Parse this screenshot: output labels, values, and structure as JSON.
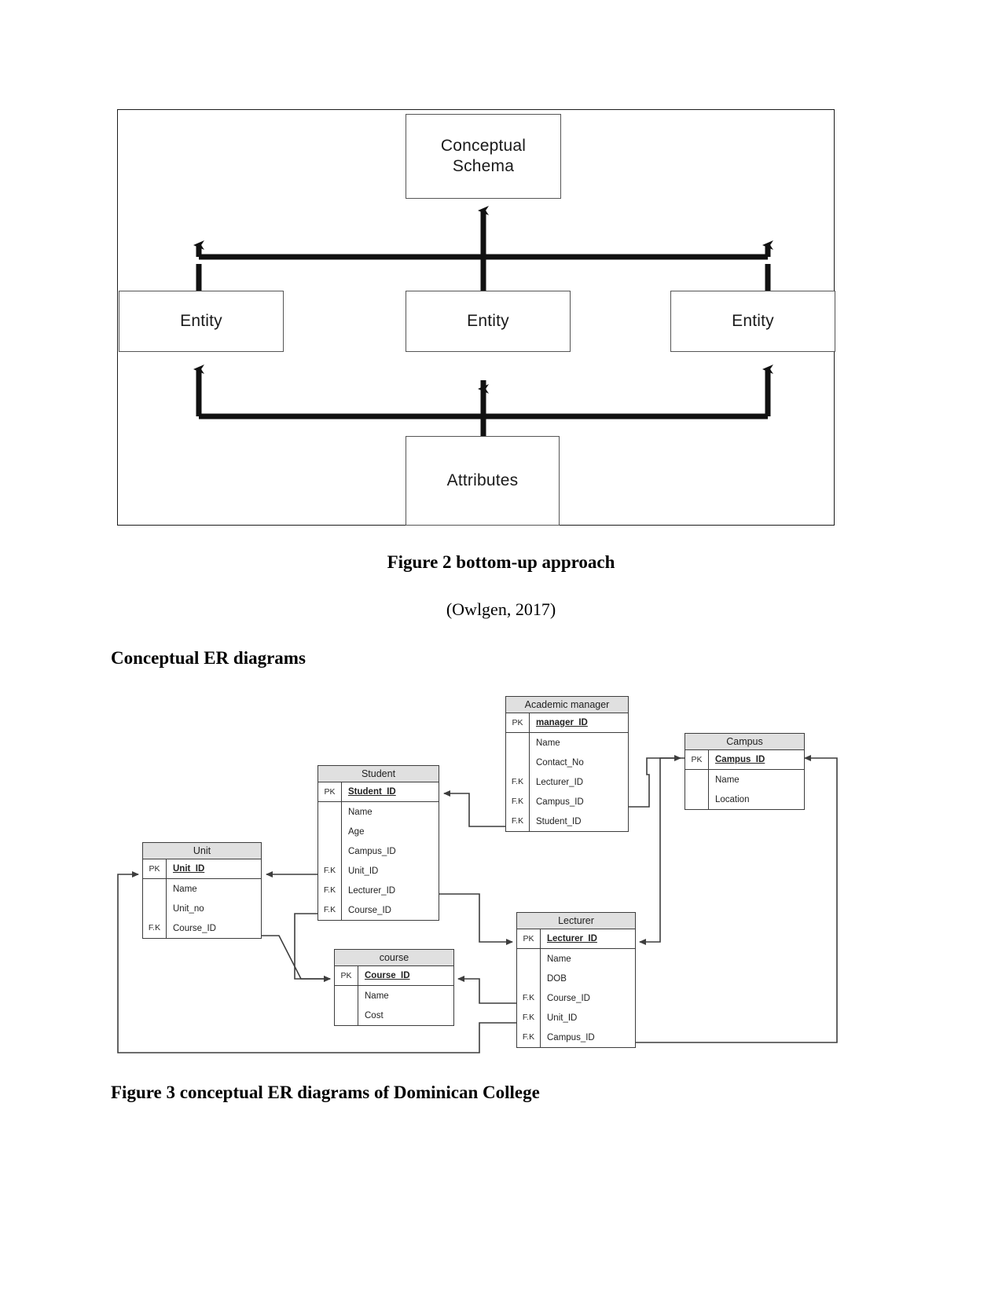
{
  "figure2": {
    "boxes": {
      "conceptual_schema": "Conceptual\nSchema",
      "conceptual_schema_line1": "Conceptual",
      "conceptual_schema_line2": "Schema",
      "entity_left": "Entity",
      "entity_center": "Entity",
      "entity_right": "Entity",
      "attributes": "Attributes"
    },
    "caption": "Figure 2 bottom-up approach",
    "source": "(Owlgen, 2017)"
  },
  "heading": "Conceptual ER diagrams",
  "figure3": {
    "caption": "Figure 3 conceptual ER diagrams of Dominican College",
    "entities": [
      {
        "id": "academic-manager",
        "title": "Academic manager",
        "pk": {
          "key": "PK",
          "attr": "manager_ID"
        },
        "rows": [
          {
            "key": "",
            "attr": "Name"
          },
          {
            "key": "",
            "attr": "Contact_No"
          },
          {
            "key": "F.K",
            "attr": "Lecturer_ID"
          },
          {
            "key": "F.K",
            "attr": "Campus_ID"
          },
          {
            "key": "F.K",
            "attr": "Student_ID"
          }
        ]
      },
      {
        "id": "campus",
        "title": "Campus",
        "pk": {
          "key": "PK",
          "attr": "Campus_ID"
        },
        "rows": [
          {
            "key": "",
            "attr": "Name"
          },
          {
            "key": "",
            "attr": "Location"
          }
        ]
      },
      {
        "id": "student",
        "title": "Student",
        "pk": {
          "key": "PK",
          "attr": "Student_ID"
        },
        "rows": [
          {
            "key": "",
            "attr": "Name"
          },
          {
            "key": "",
            "attr": "Age"
          },
          {
            "key": "",
            "attr": "Campus_ID"
          },
          {
            "key": "F.K",
            "attr": "Unit_ID"
          },
          {
            "key": "F.K",
            "attr": "Lecturer_ID"
          },
          {
            "key": "F.K",
            "attr": "Course_ID"
          }
        ]
      },
      {
        "id": "unit",
        "title": "Unit",
        "pk": {
          "key": "PK",
          "attr": "Unit_ID"
        },
        "rows": [
          {
            "key": "",
            "attr": "Name"
          },
          {
            "key": "",
            "attr": "Unit_no"
          },
          {
            "key": "F.K",
            "attr": "Course_ID"
          }
        ]
      },
      {
        "id": "course",
        "title": "course",
        "pk": {
          "key": "PK",
          "attr": "Course_ID"
        },
        "rows": [
          {
            "key": "",
            "attr": "Name"
          },
          {
            "key": "",
            "attr": "Cost"
          }
        ]
      },
      {
        "id": "lecturer",
        "title": "Lecturer",
        "pk": {
          "key": "PK",
          "attr": "Lecturer_ID"
        },
        "rows": [
          {
            "key": "",
            "attr": "Name"
          },
          {
            "key": "",
            "attr": "DOB"
          },
          {
            "key": "F.K",
            "attr": "Course_ID"
          },
          {
            "key": "F.K",
            "attr": "Unit_ID"
          },
          {
            "key": "F.K",
            "attr": "Campus_ID"
          }
        ]
      }
    ]
  },
  "colors": {
    "entity_header_fill": "#e0e0e0",
    "entity_border": "#3d3d3d",
    "diagram_line": "#1c1c1c",
    "page_background": "#ffffff"
  }
}
